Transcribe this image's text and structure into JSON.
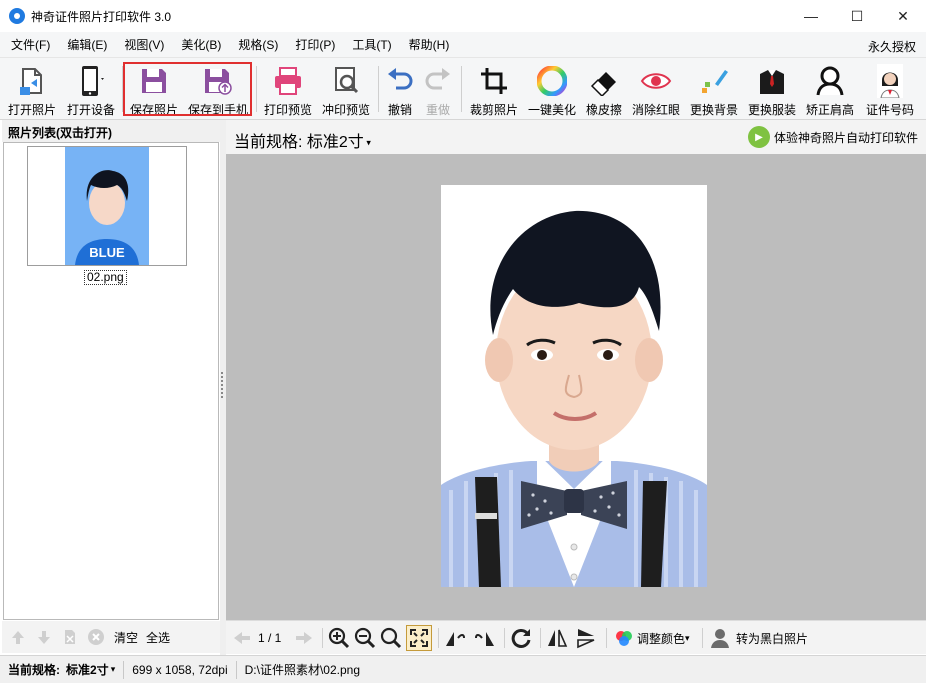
{
  "window": {
    "title": "神奇证件照片打印软件 3.0",
    "controls": {
      "minimize": "—",
      "maximize": "☐",
      "close": "✕"
    }
  },
  "menu": {
    "items": [
      "文件(F)",
      "编辑(E)",
      "视图(V)",
      "美化(B)",
      "规格(S)",
      "打印(P)",
      "工具(T)",
      "帮助(H)"
    ],
    "right": "永久授权"
  },
  "toolbar": {
    "open_photo": "打开照片",
    "open_device": "打开设备",
    "save_photo": "保存照片",
    "save_to_phone": "保存到手机",
    "print_preview": "打印预览",
    "develop_preview": "冲印预览",
    "undo": "撤销",
    "redo": "重做",
    "crop": "裁剪照片",
    "beautify": "一键美化",
    "eraser": "橡皮擦",
    "red_eye": "消除红眼",
    "change_bg": "更换背景",
    "change_clothes": "更换服装",
    "shoulders": "矫正肩高",
    "id_code": "证件号码"
  },
  "left": {
    "header": "照片列表(双击打开)",
    "thumb_filename": "02.png",
    "thumb_shirt_text": "BLUE",
    "clear": "清空",
    "select_all": "全选"
  },
  "right": {
    "spec_prefix": "当前规格:",
    "spec_value": "标准2寸",
    "ad_label": "体验神奇照片自动打印软件",
    "page_indicator": "1 / 1",
    "adjust_color": "调整颜色",
    "to_bw": "转为黑白照片"
  },
  "status": {
    "spec_prefix": "当前规格:",
    "spec_value": "标准2寸",
    "dimensions": "699 x 1058, 72dpi",
    "path": "D:\\证件照素材\\02.png"
  },
  "colors": {
    "accent_blue": "#1f7ae0",
    "highlight_red": "#e02f2f",
    "canvas_gray": "#bdbdbd",
    "thumb_bg": "#77b3f5"
  }
}
